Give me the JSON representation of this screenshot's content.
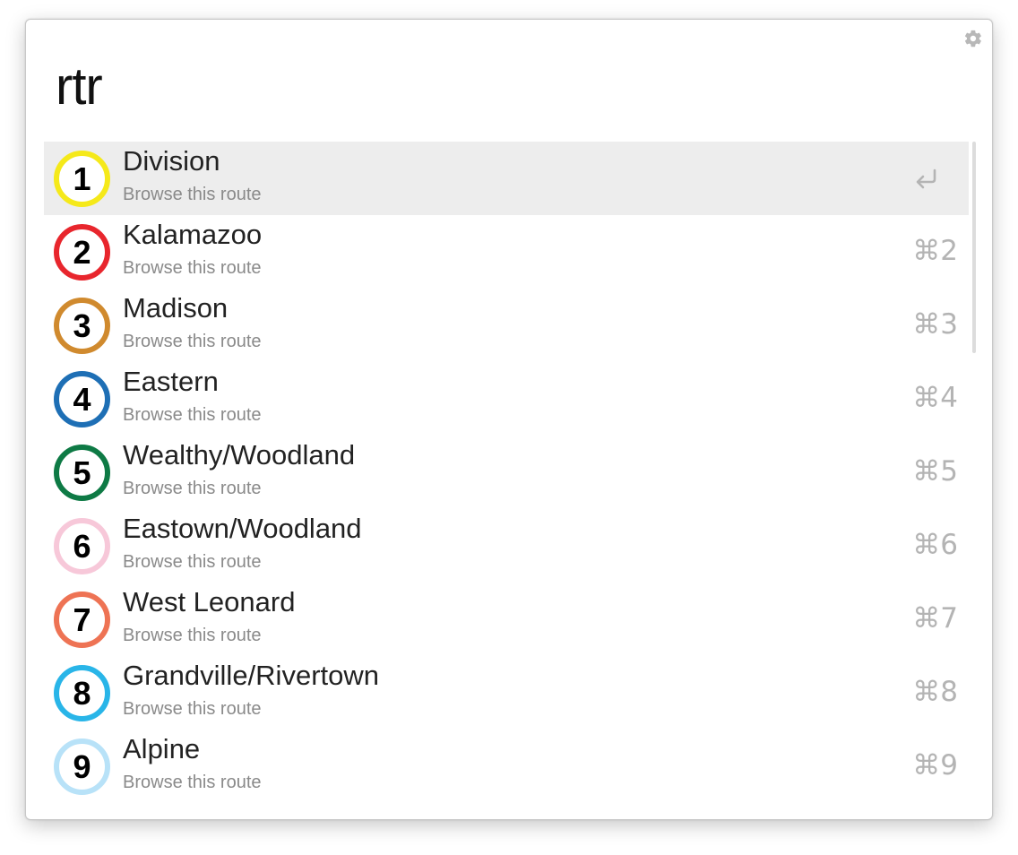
{
  "search": {
    "query": "rtr"
  },
  "results": [
    {
      "number": "1",
      "title": "Division",
      "subtitle": "Browse this route",
      "color": "#f5e91a",
      "shortcut": ""
    },
    {
      "number": "2",
      "title": "Kalamazoo",
      "subtitle": "Browse this route",
      "color": "#e8262d",
      "shortcut": "⌘2"
    },
    {
      "number": "3",
      "title": "Madison",
      "subtitle": "Browse this route",
      "color": "#d08a2e",
      "shortcut": "⌘3"
    },
    {
      "number": "4",
      "title": "Eastern",
      "subtitle": "Browse this route",
      "color": "#1e6fb5",
      "shortcut": "⌘4"
    },
    {
      "number": "5",
      "title": "Wealthy/Woodland",
      "subtitle": "Browse this route",
      "color": "#0e7a45",
      "shortcut": "⌘5"
    },
    {
      "number": "6",
      "title": "Eastown/Woodland",
      "subtitle": "Browse this route",
      "color": "#f7c8d9",
      "shortcut": "⌘6"
    },
    {
      "number": "7",
      "title": "West Leonard",
      "subtitle": "Browse this route",
      "color": "#ee7354",
      "shortcut": "⌘7"
    },
    {
      "number": "8",
      "title": "Grandville/Rivertown",
      "subtitle": "Browse this route",
      "color": "#29b5e8",
      "shortcut": "⌘8"
    },
    {
      "number": "9",
      "title": "Alpine",
      "subtitle": "Browse this route",
      "color": "#b8e2f8",
      "shortcut": "⌘9"
    }
  ],
  "selected_index": 0,
  "icons": {
    "settings": "gear-icon",
    "selected_action": "return-icon"
  },
  "colors": {
    "selected_row": "#ededed",
    "subtitle": "#8a8a8a",
    "shortcut": "#b4b4b4"
  }
}
